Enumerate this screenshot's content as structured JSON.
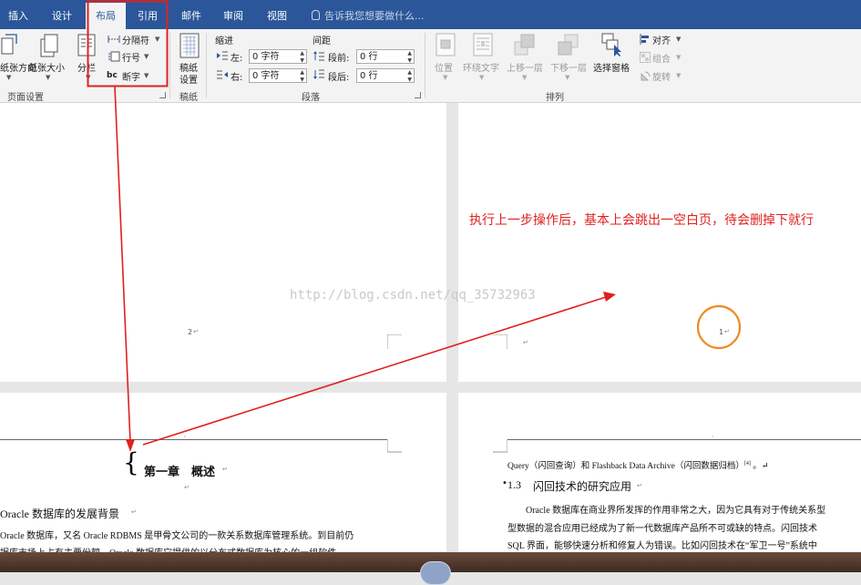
{
  "tabs": [
    {
      "label": "插入",
      "active": false
    },
    {
      "label": "设计",
      "active": false
    },
    {
      "label": "布局",
      "active": true
    },
    {
      "label": "引用",
      "active": false
    },
    {
      "label": "邮件",
      "active": false
    },
    {
      "label": "审阅",
      "active": false
    },
    {
      "label": "视图",
      "active": false
    }
  ],
  "tell_me": "告诉我您想要做什么...",
  "ribbon": {
    "page_setup": {
      "group_label": "页面设置",
      "orientation": "纸张方向",
      "size": "纸张大小",
      "columns": "分栏",
      "breaks": "分隔符",
      "line_numbers": "行号",
      "hyphenation": "断字",
      "hyph_prefix": "bc"
    },
    "draft_paper": {
      "group_label": "稿纸",
      "button": "稿纸设置",
      "line1": "稿纸",
      "line2": "设置"
    },
    "paragraph": {
      "group_label": "段落",
      "indent_title": "缩进",
      "spacing_title": "间距",
      "left_label": "左:",
      "right_label": "右:",
      "left_value": "0 字符",
      "right_value": "0 字符",
      "before_label": "段前:",
      "after_label": "段后:",
      "before_value": "0 行",
      "after_value": "0 行"
    },
    "arrange": {
      "group_label": "排列",
      "position": "位置",
      "wrap_text": "环绕文字",
      "bring_forward": "上移一层",
      "send_backward": "下移一层",
      "selection_pane": "选择窗格",
      "align": "对齐",
      "group": "组合",
      "rotate": "旋转"
    }
  },
  "document": {
    "annotation": "执行上一步操作后，基本上会跳出一空白页，待会删掉下就行",
    "watermark": "http://blog.csdn.net/qq_35732963",
    "page_num_left": "2",
    "page_num_right": "1",
    "chapter_title": "第一章　概述",
    "section_heading": "Oracle 数据库的发展背景",
    "body_line1": "Oracle 数据库，又名 Oracle RDBMS 是甲骨文公司的一款关系数据库管理系统。到目前仍",
    "body_line2": "据库市场上占有主要份额。Oracle 数据库它提供的以分布式数据库为核心的一组软件",
    "right_line1": "Query（闪回查询）和 Flashback Data Archive（闪回数据归档）",
    "right_line1_sup": "[4]",
    "right_heading_num": "1.3",
    "right_heading": "闪回技术的研究应用",
    "right_body1": "Oracle 数据库在商业界所发挥的作用非常之大，因为它具有对于传统关系型",
    "right_body2": "型数据的混合应用已经成为了新一代数据库产品所不可或缺的特点。闪回技术",
    "right_body3": "SQL 界面，能够快速分析和修复人为错误。比如闪回技术在“军卫一号”系统中"
  },
  "colors": {
    "title_bar": "#2b579a",
    "highlight_box": "#e02020",
    "arrow": "#e02020",
    "annotation_text": "#e02020",
    "circle": "#f08a24"
  }
}
